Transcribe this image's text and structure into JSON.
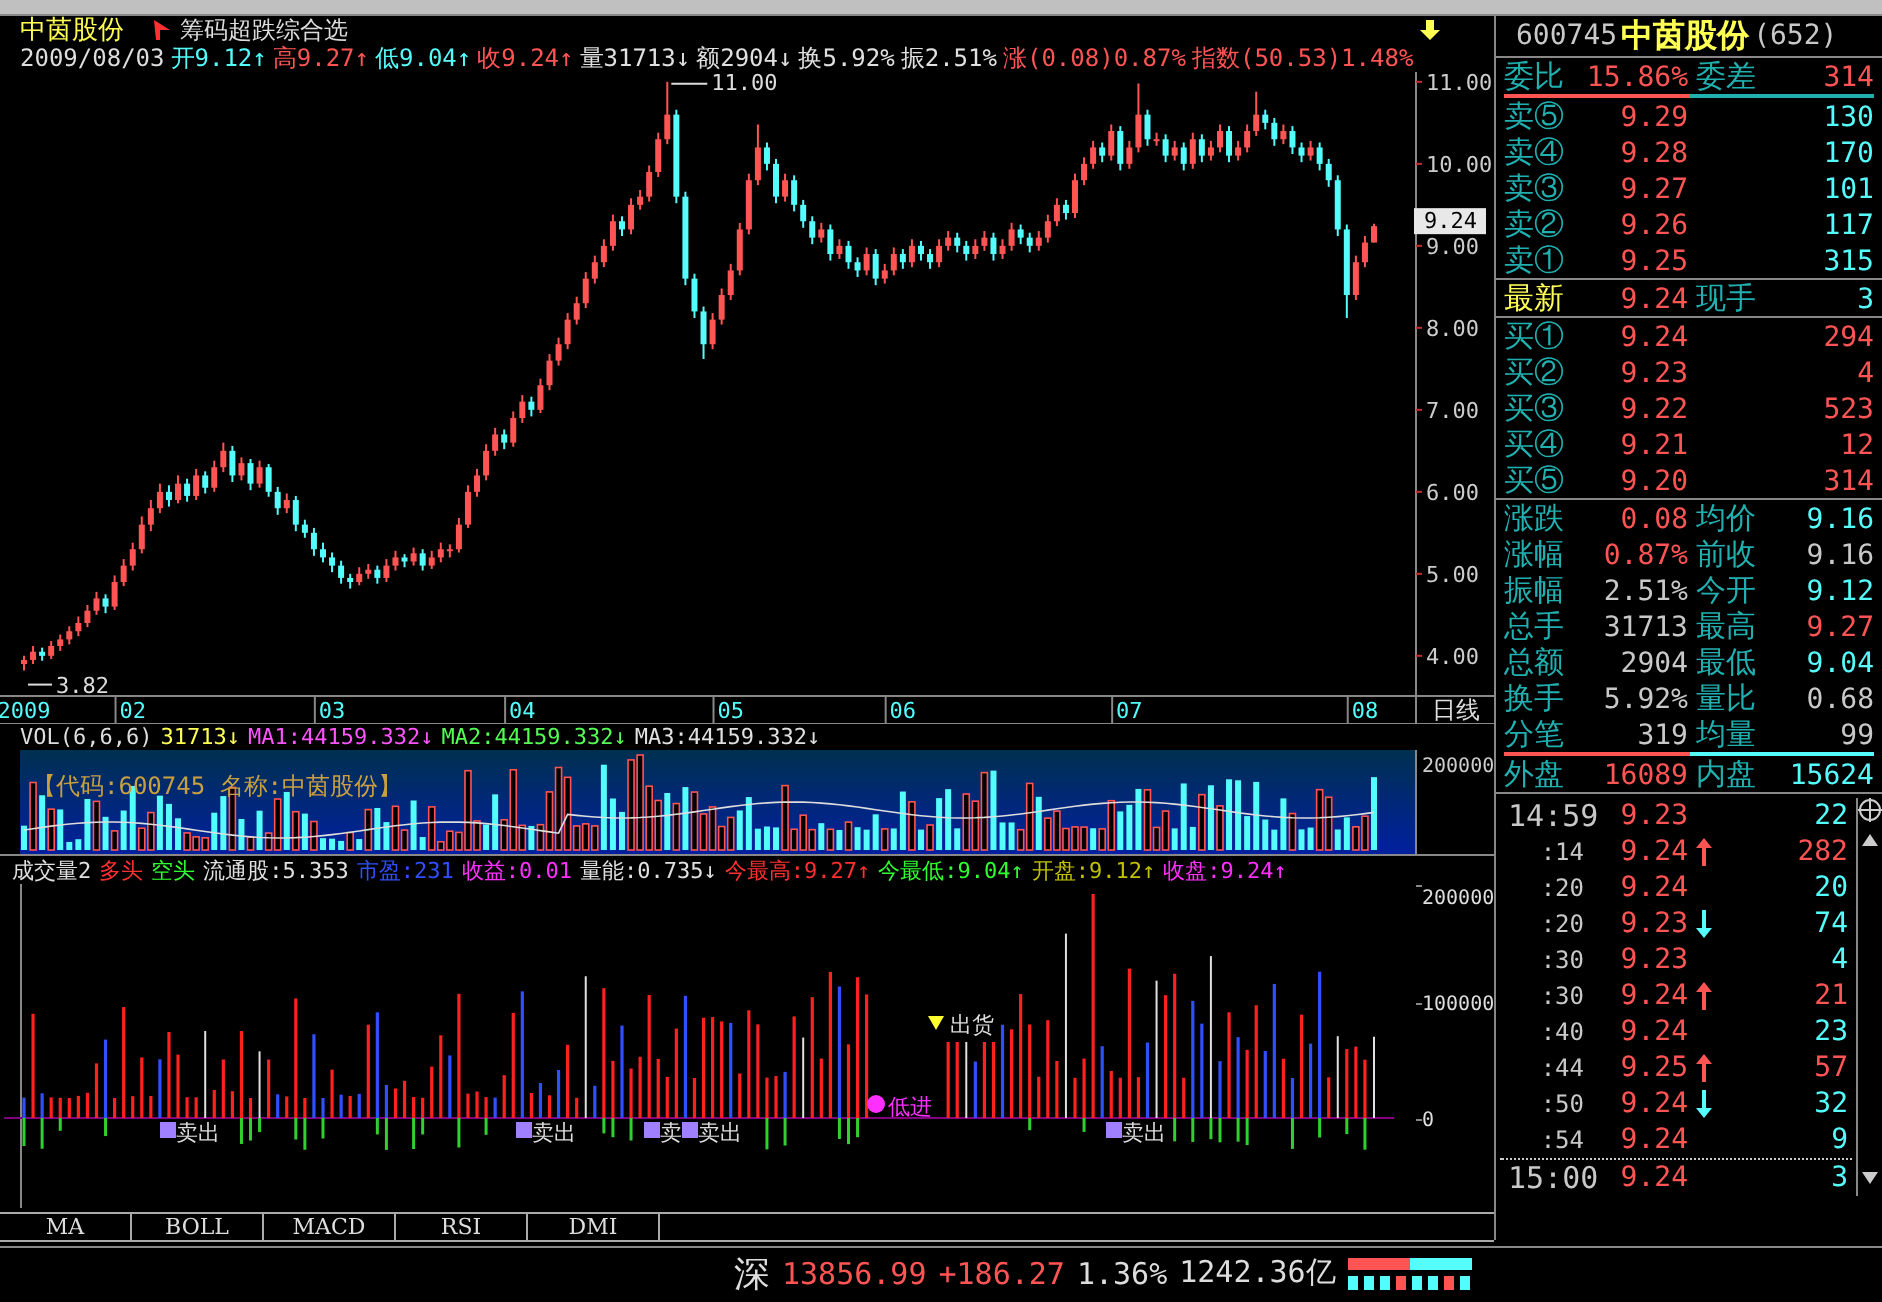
{
  "title_bar": {
    "stock_name": "中茵股份",
    "formula_name": "筹码超跌综合选"
  },
  "quote_line": {
    "date": "2009/08/03",
    "items": [
      {
        "text": "开9.12↑",
        "color": "#54fcfc"
      },
      {
        "text": "高9.27↑",
        "color": "#ff5454"
      },
      {
        "text": "低9.04↑",
        "color": "#54fcfc"
      },
      {
        "text": "收9.24↑",
        "color": "#ff5454"
      },
      {
        "text": "量31713↓",
        "color": "#e0e0e0"
      },
      {
        "text": "额2904↓",
        "color": "#e0e0e0"
      },
      {
        "text": "换5.92%",
        "color": "#e0e0e0"
      },
      {
        "text": "振2.51%",
        "color": "#e0e0e0"
      },
      {
        "text": "涨(0.08)0.87%",
        "color": "#ff5454"
      },
      {
        "text": "指数(50.53)1.48%",
        "color": "#ff5454"
      }
    ]
  },
  "price_chart": {
    "high_marker": "11.00",
    "low_marker": "3.82",
    "last_price_tag": "9.24",
    "period": "日线",
    "chart_data": {
      "type": "candlestick",
      "categories": [
        "2009",
        null,
        null,
        null,
        null,
        null,
        null,
        null,
        null,
        null,
        null,
        null,
        "02",
        null,
        null,
        null,
        null,
        null,
        null,
        null,
        null,
        null,
        null,
        null,
        null,
        null,
        null,
        null,
        null,
        null,
        null,
        null,
        null,
        null,
        "03",
        null,
        null,
        null,
        null,
        null,
        null,
        null,
        null,
        null,
        null,
        null,
        null,
        null,
        null,
        null,
        null,
        null,
        null,
        null,
        null,
        "04",
        null,
        null,
        null,
        null,
        null,
        null,
        null,
        null,
        null,
        null,
        null,
        null,
        null,
        null,
        null,
        null,
        null,
        null,
        null,
        null,
        null,
        null,
        "05",
        null,
        null,
        null,
        null,
        null,
        null,
        null,
        null,
        null,
        null,
        null,
        null,
        null,
        null,
        null,
        null,
        null,
        null,
        "06",
        null,
        null,
        null,
        null,
        null,
        null,
        null,
        null,
        null,
        null,
        null,
        null,
        null,
        null,
        null,
        null,
        null,
        null,
        null,
        null,
        null,
        null,
        null,
        null,
        "07",
        null,
        null,
        null,
        null,
        null,
        null,
        null,
        null,
        null,
        null,
        null,
        null,
        null,
        null,
        null,
        null,
        null,
        null,
        null,
        null,
        null,
        null,
        null,
        null,
        null,
        "08",
        null
      ],
      "ylim": [
        3.51,
        11.12
      ],
      "yticks": [
        {
          "value": 11,
          "label": "11.00"
        },
        {
          "value": 10,
          "label": "10.00"
        },
        {
          "value": 9,
          "label": "9.00"
        },
        {
          "value": 8,
          "label": "8.00"
        },
        {
          "value": 7,
          "label": "7.00"
        },
        {
          "value": 6,
          "label": "6.00"
        },
        {
          "value": 5,
          "label": "5.00"
        },
        {
          "value": 4,
          "label": "4.00"
        }
      ],
      "ohlc": [
        [
          3.9,
          4.0,
          3.82,
          3.95
        ],
        [
          3.95,
          4.12,
          3.9,
          4.05
        ],
        [
          4.05,
          4.1,
          3.94,
          4.0
        ],
        [
          4.0,
          4.18,
          3.96,
          4.12
        ],
        [
          4.12,
          4.26,
          4.06,
          4.2
        ],
        [
          4.2,
          4.36,
          4.14,
          4.3
        ],
        [
          4.3,
          4.48,
          4.24,
          4.4
        ],
        [
          4.4,
          4.62,
          4.35,
          4.55
        ],
        [
          4.55,
          4.78,
          4.5,
          4.7
        ],
        [
          4.7,
          4.75,
          4.52,
          4.6
        ],
        [
          4.6,
          4.98,
          4.56,
          4.9
        ],
        [
          4.9,
          5.18,
          4.85,
          5.1
        ],
        [
          5.1,
          5.38,
          5.04,
          5.3
        ],
        [
          5.3,
          5.7,
          5.25,
          5.6
        ],
        [
          5.6,
          5.9,
          5.52,
          5.8
        ],
        [
          5.8,
          6.1,
          5.74,
          6.0
        ],
        [
          6.0,
          6.08,
          5.82,
          5.9
        ],
        [
          5.9,
          6.2,
          5.86,
          6.1
        ],
        [
          6.1,
          6.16,
          5.88,
          5.95
        ],
        [
          5.95,
          6.28,
          5.9,
          6.2
        ],
        [
          6.2,
          6.25,
          5.98,
          6.05
        ],
        [
          6.05,
          6.38,
          6.0,
          6.3
        ],
        [
          6.3,
          6.6,
          6.24,
          6.5
        ],
        [
          6.5,
          6.56,
          6.12,
          6.2
        ],
        [
          6.2,
          6.42,
          6.14,
          6.35
        ],
        [
          6.35,
          6.4,
          6.02,
          6.1
        ],
        [
          6.1,
          6.38,
          6.05,
          6.3
        ],
        [
          6.3,
          6.34,
          5.94,
          6.0
        ],
        [
          6.0,
          6.06,
          5.72,
          5.8
        ],
        [
          5.8,
          5.98,
          5.74,
          5.9
        ],
        [
          5.9,
          5.95,
          5.52,
          5.6
        ],
        [
          5.6,
          5.66,
          5.44,
          5.5
        ],
        [
          5.5,
          5.56,
          5.22,
          5.3
        ],
        [
          5.3,
          5.38,
          5.14,
          5.2
        ],
        [
          5.2,
          5.26,
          5.02,
          5.1
        ],
        [
          5.1,
          5.16,
          4.88,
          4.95
        ],
        [
          4.95,
          5.0,
          4.82,
          4.9
        ],
        [
          4.9,
          5.08,
          4.86,
          5.0
        ],
        [
          5.0,
          5.12,
          4.94,
          5.05
        ],
        [
          5.05,
          5.1,
          4.88,
          4.95
        ],
        [
          4.95,
          5.18,
          4.9,
          5.1
        ],
        [
          5.1,
          5.28,
          5.04,
          5.2
        ],
        [
          5.2,
          5.24,
          5.08,
          5.15
        ],
        [
          5.15,
          5.32,
          5.1,
          5.25
        ],
        [
          5.25,
          5.3,
          5.04,
          5.1
        ],
        [
          5.1,
          5.28,
          5.06,
          5.2
        ],
        [
          5.2,
          5.38,
          5.14,
          5.3
        ],
        [
          5.3,
          5.36,
          5.2,
          5.3
        ],
        [
          5.3,
          5.68,
          5.26,
          5.6
        ],
        [
          5.6,
          6.08,
          5.56,
          6.0
        ],
        [
          6.0,
          6.28,
          5.94,
          6.2
        ],
        [
          6.2,
          6.58,
          6.14,
          6.5
        ],
        [
          6.5,
          6.78,
          6.44,
          6.7
        ],
        [
          6.7,
          6.76,
          6.52,
          6.6
        ],
        [
          6.6,
          6.98,
          6.55,
          6.9
        ],
        [
          6.9,
          7.18,
          6.84,
          7.1
        ],
        [
          7.1,
          7.16,
          6.92,
          7.0
        ],
        [
          7.0,
          7.38,
          6.96,
          7.3
        ],
        [
          7.3,
          7.68,
          7.24,
          7.6
        ],
        [
          7.6,
          7.88,
          7.54,
          7.8
        ],
        [
          7.8,
          8.18,
          7.74,
          8.1
        ],
        [
          8.1,
          8.38,
          8.04,
          8.3
        ],
        [
          8.3,
          8.68,
          8.24,
          8.6
        ],
        [
          8.6,
          8.88,
          8.54,
          8.8
        ],
        [
          8.8,
          9.08,
          8.74,
          9.0
        ],
        [
          9.0,
          9.38,
          8.94,
          9.3
        ],
        [
          9.3,
          9.36,
          9.12,
          9.2
        ],
        [
          9.2,
          9.58,
          9.14,
          9.5
        ],
        [
          9.5,
          9.68,
          9.44,
          9.6
        ],
        [
          9.6,
          9.98,
          9.54,
          9.9
        ],
        [
          9.9,
          10.38,
          9.84,
          10.3
        ],
        [
          10.3,
          11.0,
          10.24,
          10.6
        ],
        [
          10.6,
          10.66,
          9.52,
          9.6
        ],
        [
          9.6,
          9.66,
          8.52,
          8.6
        ],
        [
          8.6,
          8.66,
          8.12,
          8.2
        ],
        [
          8.2,
          8.26,
          7.62,
          7.8
        ],
        [
          7.8,
          8.18,
          7.74,
          8.1
        ],
        [
          8.1,
          8.48,
          8.04,
          8.4
        ],
        [
          8.4,
          8.78,
          8.34,
          8.7
        ],
        [
          8.7,
          9.28,
          8.64,
          9.2
        ],
        [
          9.2,
          9.88,
          9.14,
          9.8
        ],
        [
          9.8,
          10.48,
          9.74,
          10.2
        ],
        [
          10.2,
          10.26,
          9.92,
          10.0
        ],
        [
          10.0,
          10.06,
          9.52,
          9.6
        ],
        [
          9.6,
          9.88,
          9.54,
          9.8
        ],
        [
          9.8,
          9.86,
          9.42,
          9.5
        ],
        [
          9.5,
          9.56,
          9.22,
          9.3
        ],
        [
          9.3,
          9.36,
          9.02,
          9.1
        ],
        [
          9.1,
          9.28,
          9.04,
          9.2
        ],
        [
          9.2,
          9.26,
          8.82,
          8.9
        ],
        [
          8.9,
          9.08,
          8.84,
          9.0
        ],
        [
          9.0,
          9.06,
          8.72,
          8.8
        ],
        [
          8.8,
          8.86,
          8.62,
          8.7
        ],
        [
          8.7,
          8.98,
          8.64,
          8.9
        ],
        [
          8.9,
          8.96,
          8.52,
          8.6
        ],
        [
          8.6,
          8.78,
          8.54,
          8.7
        ],
        [
          8.7,
          8.98,
          8.64,
          8.9
        ],
        [
          8.9,
          8.96,
          8.72,
          8.8
        ],
        [
          8.8,
          9.08,
          8.74,
          9.0
        ],
        [
          9.0,
          9.06,
          8.82,
          8.9
        ],
        [
          8.9,
          8.96,
          8.72,
          8.8
        ],
        [
          8.8,
          9.08,
          8.74,
          9.0
        ],
        [
          9.0,
          9.18,
          8.94,
          9.1
        ],
        [
          9.1,
          9.16,
          8.92,
          9.0
        ],
        [
          9.0,
          9.06,
          8.82,
          8.9
        ],
        [
          8.9,
          9.08,
          8.84,
          9.0
        ],
        [
          9.0,
          9.18,
          8.94,
          9.1
        ],
        [
          9.1,
          9.16,
          8.82,
          8.9
        ],
        [
          8.9,
          9.08,
          8.84,
          9.0
        ],
        [
          9.0,
          9.28,
          8.94,
          9.2
        ],
        [
          9.2,
          9.26,
          9.02,
          9.1
        ],
        [
          9.1,
          9.16,
          8.92,
          9.0
        ],
        [
          9.0,
          9.18,
          8.94,
          9.1
        ],
        [
          9.1,
          9.38,
          9.04,
          9.3
        ],
        [
          9.3,
          9.58,
          9.24,
          9.5
        ],
        [
          9.5,
          9.56,
          9.32,
          9.4
        ],
        [
          9.4,
          9.88,
          9.34,
          9.8
        ],
        [
          9.8,
          10.08,
          9.74,
          10.0
        ],
        [
          10.0,
          10.28,
          9.94,
          10.2
        ],
        [
          10.2,
          10.26,
          10.02,
          10.1
        ],
        [
          10.1,
          10.48,
          10.04,
          10.4
        ],
        [
          10.4,
          10.46,
          9.92,
          10.0
        ],
        [
          10.0,
          10.28,
          9.94,
          10.2
        ],
        [
          10.2,
          10.98,
          10.14,
          10.6
        ],
        [
          10.6,
          10.66,
          10.22,
          10.3
        ],
        [
          10.3,
          10.38,
          10.22,
          10.3
        ],
        [
          10.3,
          10.36,
          10.02,
          10.1
        ],
        [
          10.1,
          10.28,
          10.04,
          10.2
        ],
        [
          10.2,
          10.26,
          9.92,
          10.0
        ],
        [
          10.0,
          10.38,
          9.94,
          10.3
        ],
        [
          10.3,
          10.36,
          10.02,
          10.1
        ],
        [
          10.1,
          10.28,
          10.04,
          10.2
        ],
        [
          10.2,
          10.48,
          10.14,
          10.4
        ],
        [
          10.4,
          10.46,
          10.02,
          10.1
        ],
        [
          10.1,
          10.28,
          10.04,
          10.2
        ],
        [
          10.2,
          10.48,
          10.14,
          10.4
        ],
        [
          10.4,
          10.88,
          10.34,
          10.6
        ],
        [
          10.6,
          10.66,
          10.42,
          10.5
        ],
        [
          10.5,
          10.56,
          10.22,
          10.3
        ],
        [
          10.3,
          10.48,
          10.24,
          10.4
        ],
        [
          10.4,
          10.46,
          10.12,
          10.2
        ],
        [
          10.2,
          10.26,
          10.02,
          10.1
        ],
        [
          10.1,
          10.28,
          10.04,
          10.2
        ],
        [
          10.2,
          10.26,
          9.92,
          10.0
        ],
        [
          10.0,
          10.06,
          9.72,
          9.8
        ],
        [
          9.8,
          9.86,
          9.12,
          9.2
        ],
        [
          9.2,
          9.26,
          8.12,
          8.4
        ],
        [
          8.4,
          8.88,
          8.34,
          8.8
        ],
        [
          8.8,
          9.12,
          8.74,
          9.04
        ],
        [
          9.04,
          9.27,
          9.04,
          9.24
        ]
      ]
    }
  },
  "volume_chart": {
    "title": "VOL(6,6,6)",
    "items": [
      {
        "text": "31713↓",
        "color": "#ffff54"
      },
      {
        "text": "MA1:44159.332↓",
        "color": "#ff54ff"
      },
      {
        "text": "MA2:44159.332↓",
        "color": "#54ff54"
      },
      {
        "text": "MA3:44159.332↓",
        "color": "#e0e0e0"
      }
    ],
    "stock_info": "【代码:600745 名称:中茵股份】",
    "y_label": "200000"
  },
  "indicator_chart": {
    "items": [
      {
        "text": "成交量2",
        "color": "#e0e0e0"
      },
      {
        "text": "多头",
        "color": "#ff3030"
      },
      {
        "text": "空头",
        "color": "#30ff30"
      },
      {
        "text": "流通股:5.353",
        "color": "#e0e0e0"
      },
      {
        "text": "市盈:231",
        "color": "#3050ff"
      },
      {
        "text": "收益:0.01",
        "color": "#ff30ff"
      },
      {
        "text": "量能:0.735↓",
        "color": "#e0e0e0"
      },
      {
        "text": "今最高:9.27↑",
        "color": "#ff3030"
      },
      {
        "text": "今最低:9.04↑",
        "color": "#30ff30"
      },
      {
        "text": "开盘:9.12↑",
        "color": "#c0c000"
      },
      {
        "text": "收盘:9.24↑",
        "color": "#ff30ff"
      }
    ],
    "y_labels": [
      "200000",
      "100000",
      "0"
    ],
    "signals": [
      {
        "kind": "sell",
        "label": "卖出"
      },
      {
        "kind": "sell",
        "label": "卖出"
      },
      {
        "kind": "sell",
        "label": "卖"
      },
      {
        "kind": "sell",
        "label": "卖出"
      },
      {
        "kind": "sell",
        "label": "卖出"
      },
      {
        "kind": "distribute",
        "label": "出货"
      },
      {
        "kind": "buy_low",
        "label": "低进"
      }
    ]
  },
  "indicator_tabs": [
    "MA",
    "BOLL",
    "MACD",
    "RSI",
    "DMI"
  ],
  "quote_panel": {
    "code": "600745",
    "name": "中茵股份",
    "count": "(652)",
    "ratio": {
      "label": "委比",
      "value": "15.86%",
      "diff_label": "委差",
      "diff_value": "314"
    },
    "asks": [
      {
        "label": "卖⑤",
        "price": "9.29",
        "volume": "130"
      },
      {
        "label": "卖④",
        "price": "9.28",
        "volume": "170"
      },
      {
        "label": "卖③",
        "price": "9.27",
        "volume": "101"
      },
      {
        "label": "卖②",
        "price": "9.26",
        "volume": "117"
      },
      {
        "label": "卖①",
        "price": "9.25",
        "volume": "315"
      }
    ],
    "last": {
      "label": "最新",
      "price": "9.24",
      "volume_label": "现手",
      "volume": "3"
    },
    "bids": [
      {
        "label": "买①",
        "price": "9.24",
        "volume": "294"
      },
      {
        "label": "买②",
        "price": "9.23",
        "volume": "4"
      },
      {
        "label": "买③",
        "price": "9.22",
        "volume": "523"
      },
      {
        "label": "买④",
        "price": "9.21",
        "volume": "12"
      },
      {
        "label": "买⑤",
        "price": "9.20",
        "volume": "314"
      }
    ],
    "stats": [
      [
        {
          "label": "涨跌",
          "value": "0.08",
          "color": "#ff5454"
        },
        {
          "label": "均价",
          "value": "9.16",
          "color": "#54fcfc"
        }
      ],
      [
        {
          "label": "涨幅",
          "value": "0.87%",
          "color": "#ff5454"
        },
        {
          "label": "前收",
          "value": "9.16",
          "color": "#c8c8c8"
        }
      ],
      [
        {
          "label": "振幅",
          "value": "2.51%",
          "color": "#c8c8c8"
        },
        {
          "label": "今开",
          "value": "9.12",
          "color": "#54fcfc"
        }
      ],
      [
        {
          "label": "总手",
          "value": "31713",
          "color": "#c8c8c8"
        },
        {
          "label": "最高",
          "value": "9.27",
          "color": "#ff5454"
        }
      ],
      [
        {
          "label": "总额",
          "value": "2904",
          "color": "#c8c8c8"
        },
        {
          "label": "最低",
          "value": "9.04",
          "color": "#54fcfc"
        }
      ],
      [
        {
          "label": "换手",
          "value": "5.92%",
          "color": "#c8c8c8"
        },
        {
          "label": "量比",
          "value": "0.68",
          "color": "#c8c8c8"
        }
      ],
      [
        {
          "label": "分笔",
          "value": "319",
          "color": "#c8c8c8"
        },
        {
          "label": "均量",
          "value": "99",
          "color": "#c8c8c8"
        }
      ]
    ],
    "outer": {
      "label": "外盘",
      "value": "16089",
      "label2": "内盘",
      "value2": "15624"
    }
  },
  "ticks": [
    {
      "time": "14:59",
      "price": "9.23",
      "kind": "flat",
      "volume": "22",
      "color": "#54fcfc"
    },
    {
      "time": ":14",
      "price": "9.24",
      "kind": "up",
      "volume": "282",
      "color": "#ff5454"
    },
    {
      "time": ":20",
      "price": "9.24",
      "kind": "flat",
      "volume": "20",
      "color": "#54fcfc"
    },
    {
      "time": ":20",
      "price": "9.23",
      "kind": "down",
      "volume": "74",
      "color": "#54fcfc"
    },
    {
      "time": ":30",
      "price": "9.23",
      "kind": "flat",
      "volume": "4",
      "color": "#54fcfc"
    },
    {
      "time": ":30",
      "price": "9.24",
      "kind": "up",
      "volume": "21",
      "color": "#ff5454"
    },
    {
      "time": ":40",
      "price": "9.24",
      "kind": "flat",
      "volume": "23",
      "color": "#54fcfc"
    },
    {
      "time": ":44",
      "price": "9.25",
      "kind": "up",
      "volume": "57",
      "color": "#ff5454"
    },
    {
      "time": ":50",
      "price": "9.24",
      "kind": "down",
      "volume": "32",
      "color": "#54fcfc"
    },
    {
      "time": ":54",
      "price": "9.24",
      "kind": "flat",
      "volume": "9",
      "color": "#54fcfc"
    },
    {
      "time": "15:00",
      "price": "9.24",
      "kind": "flat",
      "volume": "3",
      "color": "#54fcfc"
    }
  ],
  "status_bar": {
    "market": "深",
    "index": "13856.99",
    "change": "+186.27",
    "percent": "1.36%",
    "amount": "1242.36亿"
  }
}
